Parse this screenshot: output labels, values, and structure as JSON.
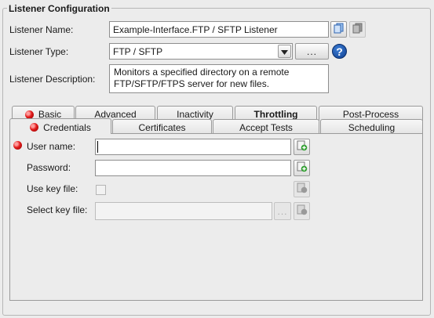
{
  "group_title": "Listener Configuration",
  "listener_name": {
    "label": "Listener Name:",
    "value": "Example-Interface.FTP / SFTP Listener"
  },
  "listener_type": {
    "label": "Listener Type:",
    "value": "FTP / SFTP",
    "browse_label": "...",
    "help_label": "?"
  },
  "listener_description": {
    "label": "Listener Description:",
    "value": "Monitors a specified directory on a remote\nFTP/SFTP/FTPS server for new files."
  },
  "tabs_row1": [
    {
      "label": "Basic",
      "error": true,
      "bold": false
    },
    {
      "label": "Advanced",
      "error": false,
      "bold": false
    },
    {
      "label": "Inactivity",
      "error": false,
      "bold": false
    },
    {
      "label": "Throttling",
      "error": false,
      "bold": true
    },
    {
      "label": "Post-Process",
      "error": false,
      "bold": false
    }
  ],
  "tabs_row2": [
    {
      "label": "Credentials",
      "error": true,
      "active": true
    },
    {
      "label": "Certificates",
      "error": false,
      "active": false
    },
    {
      "label": "Accept Tests",
      "error": false,
      "active": false
    },
    {
      "label": "Scheduling",
      "error": false,
      "active": false
    }
  ],
  "credentials": {
    "user_name": {
      "label": "User name:",
      "value": "",
      "error": true
    },
    "password": {
      "label": "Password:",
      "value": ""
    },
    "use_key_file": {
      "label": "Use key file:",
      "checked": false,
      "enabled": false
    },
    "select_key_file": {
      "label": "Select key file:",
      "value": "",
      "browse_label": "...",
      "enabled": false
    }
  },
  "icons": {
    "name_action1": "copy-icon",
    "name_action2": "copy-disabled-icon",
    "field_action": "add-variable-icon",
    "error": "error-dot-icon",
    "help": "help-icon",
    "dropdown": "dropdown-arrow-icon"
  },
  "colors": {
    "error_dot": "#e21b1b",
    "help_blue": "#1a56b8",
    "add_green": "#2e9e2e"
  }
}
